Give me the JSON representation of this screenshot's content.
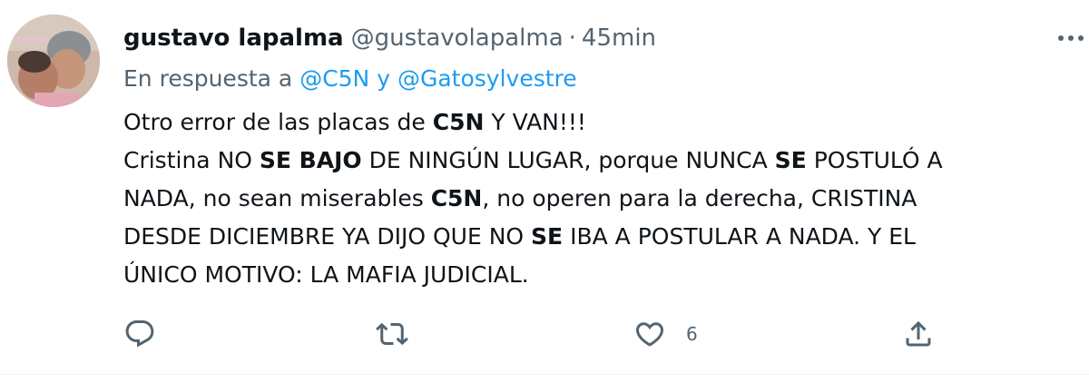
{
  "tweet": {
    "display_name": "gustavo lapalma",
    "handle": "@gustavolapalma",
    "separator": "·",
    "time": "45min",
    "reply_prefix": "En respuesta a",
    "reply_mention_1": "@C5N",
    "reply_joiner": "y",
    "reply_mention_2": "@Gatosylvestre",
    "body": {
      "l1_a": "Otro error de las placas de ",
      "l1_b": "C5N",
      "l1_c": " Y VAN!!!",
      "l2_a": "Cristina NO ",
      "l2_b": "SE BAJO",
      "l2_c": " DE NINGÚN LUGAR, porque NUNCA ",
      "l2_d": "SE",
      "l2_e": " POSTULÓ A",
      "l3_a": "NADA, no sean miserables ",
      "l3_b": "C5N",
      "l3_c": ", no operen para la derecha, CRISTINA",
      "l4_a": "DESDE DICIEMBRE YA DIJO QUE NO ",
      "l4_b": "SE",
      "l4_c": " IBA A POSTULAR A NADA. Y EL",
      "l5_a": "ÚNICO MOTIVO: LA MAFIA JUDICIAL."
    },
    "actions": {
      "reply_icon": "reply-icon",
      "retweet_icon": "retweet-icon",
      "like_icon": "heart-icon",
      "like_count": "6",
      "share_icon": "share-icon"
    },
    "colors": {
      "text": "#0f1419",
      "secondary": "#536471",
      "mention": "#1d9bf0"
    }
  }
}
